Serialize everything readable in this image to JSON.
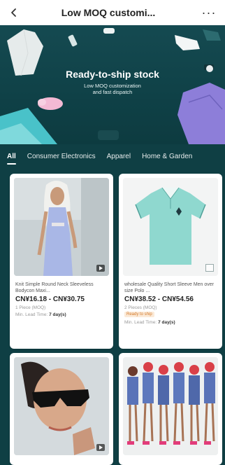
{
  "header": {
    "title": "Low MOQ customi...",
    "back_icon": "back-arrow-icon",
    "more_label": "···"
  },
  "banner": {
    "title": "Ready-to-ship stock",
    "subtitle": "Low MOQ customization\nand fast dispatch"
  },
  "tabs": [
    {
      "label": "All",
      "active": true
    },
    {
      "label": "Consumer Electronics"
    },
    {
      "label": "Apparel"
    },
    {
      "label": "Home & Garden"
    }
  ],
  "products": [
    {
      "name": "Knit Simple Round Neck Sleeveless Bodycon Maxi...",
      "price": "CN¥16.18 - CN¥30.75",
      "moq": "1 Piece (MOQ)",
      "lead_label": "Min. Lead Time:",
      "lead_value": "7 day(s)"
    },
    {
      "name": "wholesale Quality Short Sleeve Men over size Polo ...",
      "price": "CN¥38.52 - CN¥54.56",
      "moq": "2 Pieces (MOQ)",
      "badge": "Ready to ship",
      "lead_label": "Min. Lead Time:",
      "lead_value": "7 day(s)"
    },
    {
      "name": "",
      "price": "",
      "moq": ""
    },
    {
      "name": "",
      "price": "",
      "moq": ""
    }
  ],
  "colors": {
    "background": "#0f3f44",
    "header_bg": "#ffffff",
    "polo": "#8fd8cf",
    "badge_text": "#d47a2b"
  }
}
